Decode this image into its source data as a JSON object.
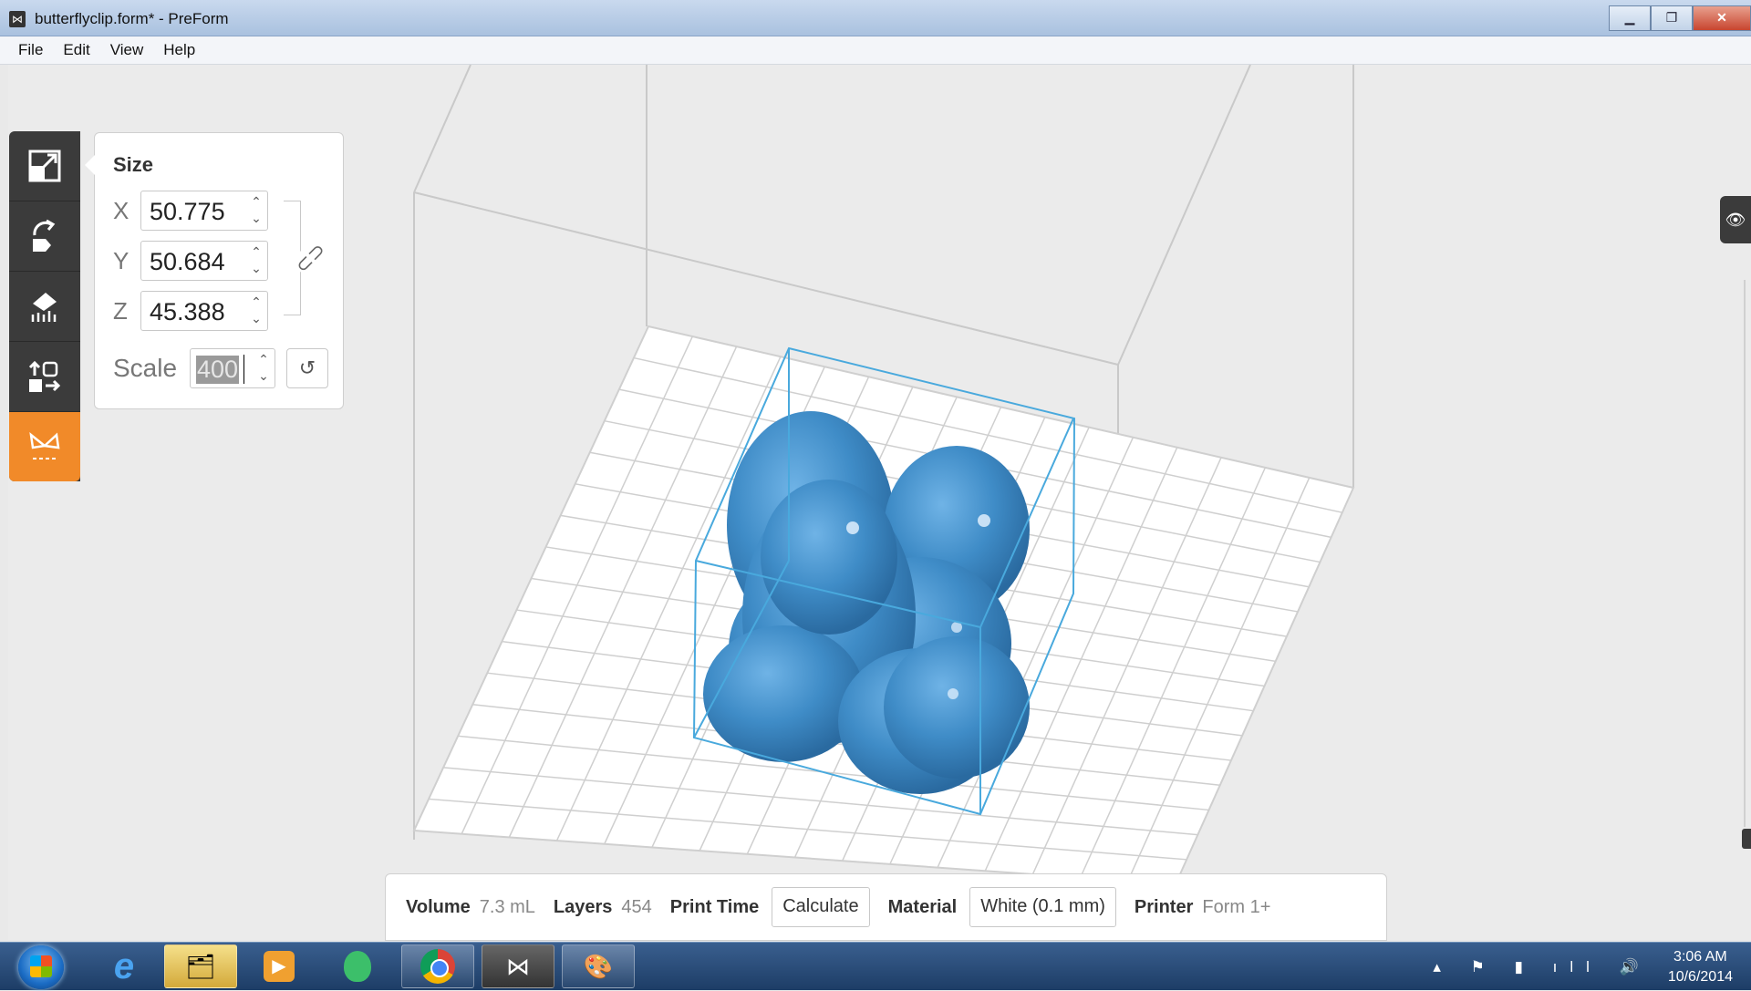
{
  "window": {
    "title": "butterflyclip.form* - PreForm",
    "app_icon": "butterfly-icon",
    "controls": [
      "minimize",
      "maximize",
      "close"
    ]
  },
  "menu": [
    "File",
    "Edit",
    "View",
    "Help"
  ],
  "toolbar": {
    "tools": [
      {
        "name": "scale-tool-button",
        "icon": "scale-icon"
      },
      {
        "name": "rotate-tool-button",
        "icon": "rotate-icon"
      },
      {
        "name": "supports-tool-button",
        "icon": "supports-icon"
      },
      {
        "name": "layout-tool-button",
        "icon": "layout-icon"
      },
      {
        "name": "print-tool-button",
        "icon": "butterfly-print-icon",
        "active": true
      }
    ]
  },
  "size_panel": {
    "title": "Size",
    "x_label": "X",
    "x_value": "50.775",
    "y_label": "Y",
    "y_value": "50.684",
    "z_label": "Z",
    "z_value": "45.388",
    "scale_label": "Scale",
    "scale_value": "400"
  },
  "status": {
    "volume_label": "Volume",
    "volume_value": "7.3 mL",
    "layers_label": "Layers",
    "layers_value": "454",
    "print_time_label": "Print Time",
    "calculate_button": "Calculate",
    "material_label": "Material",
    "material_value": "White (0.1 mm)",
    "printer_label": "Printer",
    "printer_value": "Form 1+"
  },
  "taskbar": {
    "apps": [
      "Internet Explorer",
      "Windows Explorer",
      "Media Player",
      "App",
      "Google Chrome",
      "PreForm",
      "Paint"
    ],
    "clock_time": "3:06 AM",
    "clock_date": "10/6/2014"
  },
  "colors": {
    "model": "#3f8cc7",
    "accent": "#f18a29",
    "toolbar": "#3b3b3b"
  }
}
